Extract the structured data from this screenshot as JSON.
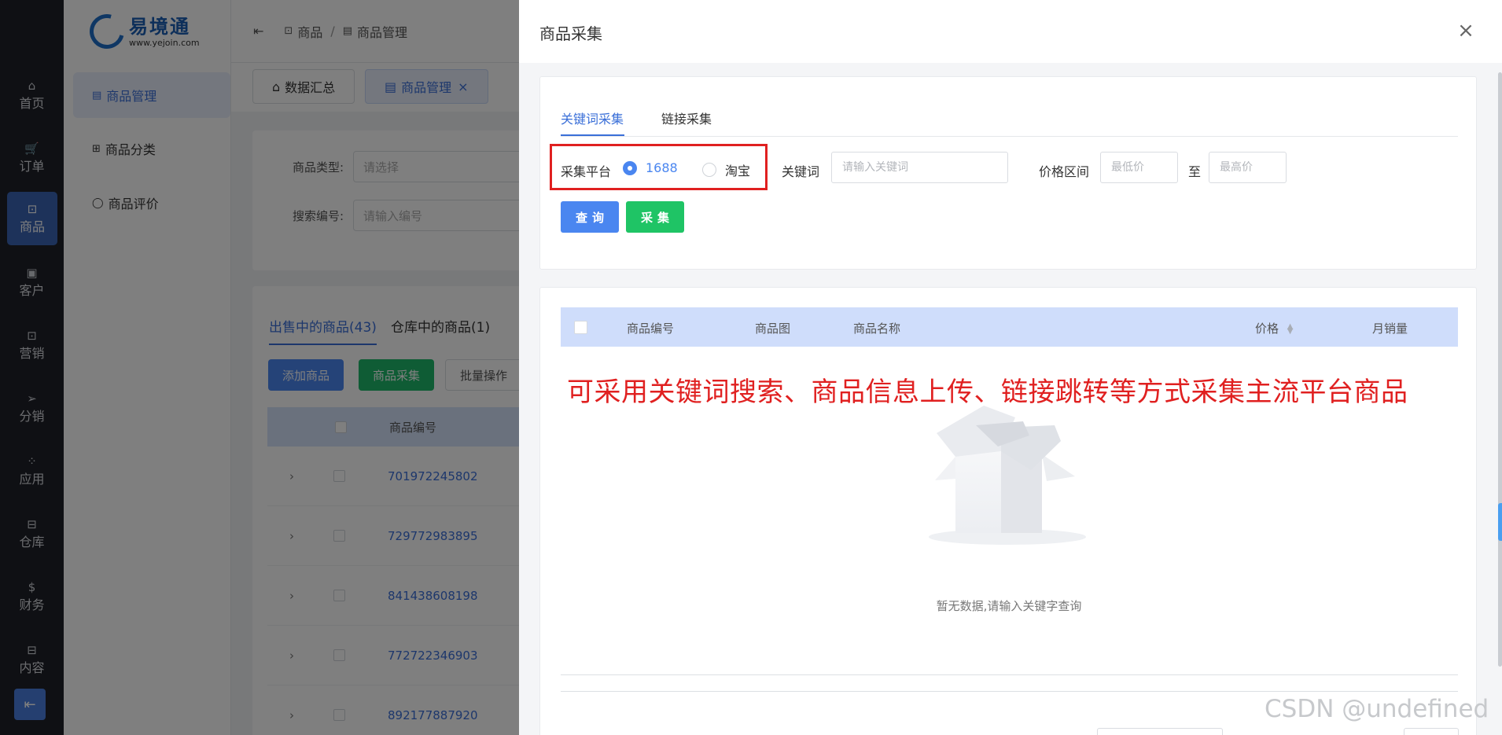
{
  "rail": {
    "items": [
      {
        "icon": "⌂",
        "label": "首页"
      },
      {
        "icon": "🛒",
        "label": "订单"
      },
      {
        "icon": "⊡",
        "label": "商品"
      },
      {
        "icon": "▣",
        "label": "客户"
      },
      {
        "icon": "⊡",
        "label": "营销"
      },
      {
        "icon": "➢",
        "label": "分销"
      },
      {
        "icon": "⁘",
        "label": "应用"
      },
      {
        "icon": "⊟",
        "label": "仓库"
      },
      {
        "icon": "$",
        "label": "财务"
      },
      {
        "icon": "⊟",
        "label": "内容"
      }
    ],
    "active_index": 2
  },
  "sidebar": {
    "logo_name": "易境通",
    "logo_url": "www.yejoin.com",
    "items": [
      {
        "icon": "▤",
        "label": "商品管理"
      },
      {
        "icon": "⊞",
        "label": "商品分类"
      },
      {
        "icon": "◯",
        "label": "商品评价"
      }
    ]
  },
  "header": {
    "breadcrumb": [
      "商品",
      "商品管理"
    ]
  },
  "page_tabs": [
    {
      "label": "数据汇总"
    },
    {
      "label": "商品管理"
    }
  ],
  "filters": {
    "type_label": "商品类型:",
    "type_placeholder": "请选择",
    "search_label": "搜索编号:",
    "search_placeholder": "请输入编号"
  },
  "list": {
    "tabs": [
      "出售中的商品(43)",
      "仓库中的商品(1)"
    ],
    "buttons": {
      "add": "添加商品",
      "collect": "商品采集",
      "batch": "批量操作"
    },
    "header_code": "商品编号",
    "rows": [
      "701972245802",
      "729772983895",
      "841438608198",
      "772722346903",
      "892177887920"
    ]
  },
  "drawer": {
    "title": "商品采集",
    "tabs": [
      "关键词采集",
      "链接采集"
    ],
    "platform_label": "采集平台",
    "platform_options": [
      "1688",
      "淘宝"
    ],
    "platform_selected": "1688",
    "keyword_label": "关键词",
    "keyword_placeholder": "请输入关键词",
    "price_label": "价格区间",
    "price_min_placeholder": "最低价",
    "price_to": "至",
    "price_max_placeholder": "最高价",
    "query_button": "查询",
    "collect_button": "采集",
    "table_headers": {
      "code": "商品编号",
      "image": "商品图",
      "name": "商品名称",
      "price": "价格",
      "sales": "月销量"
    },
    "annotation": "可采用关键词搜索、商品信息上传、链接跳转等方式采集主流平台商品",
    "empty_text": "暂无数据,请输入关键字查询"
  },
  "watermark": "CSDN @undefined",
  "colors": {
    "primary": "#4a86f0",
    "success": "#1fc465",
    "annotation_red": "#e02020",
    "rail_bg": "#1f2128"
  }
}
